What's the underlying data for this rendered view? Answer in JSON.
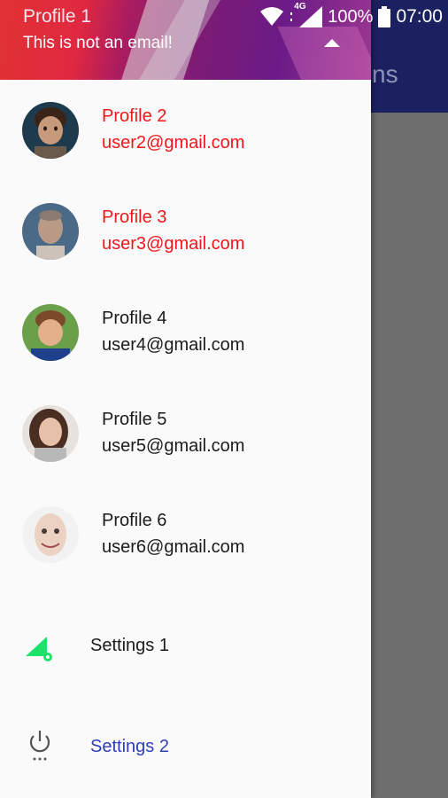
{
  "status_bar": {
    "network_label": "4G",
    "battery": "100%",
    "time": "07:00"
  },
  "background_app": {
    "title_fragment": "ns"
  },
  "drawer_header": {
    "name": "Profile 1",
    "email": "This is not an email!"
  },
  "profiles": [
    {
      "name": "Profile 2",
      "email": "user2@gmail.com",
      "selected": true
    },
    {
      "name": "Profile 3",
      "email": "user3@gmail.com",
      "selected": true
    },
    {
      "name": "Profile 4",
      "email": "user4@gmail.com",
      "selected": false
    },
    {
      "name": "Profile 5",
      "email": "user5@gmail.com",
      "selected": false
    },
    {
      "name": "Profile 6",
      "email": "user6@gmail.com",
      "selected": false
    }
  ],
  "settings": [
    {
      "label": "Settings 1",
      "icon": "signal-settings-icon"
    },
    {
      "label": "Settings 2",
      "icon": "power-settings-icon"
    }
  ],
  "colors": {
    "selected_text": "#f2161a",
    "settings_2_text": "#2f3fb3",
    "settings_1_icon": "#1ee26a",
    "toolbar": "#1b2160"
  }
}
